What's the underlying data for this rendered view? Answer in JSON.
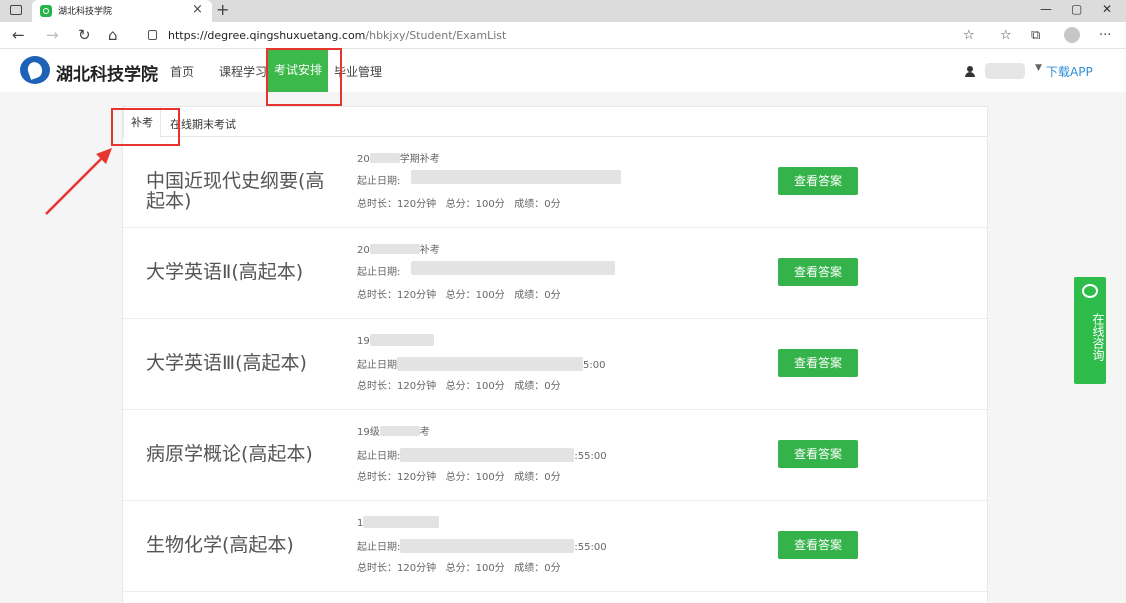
{
  "browser": {
    "tab_title": "湖北科技学院",
    "url_host": "https://degree.qingshuxuetang.com",
    "url_path": "/hbkjxy/Student/ExamList"
  },
  "site": {
    "logo": "湖北科技学院",
    "nav": [
      "首页",
      "课程学习",
      "考试安排",
      "毕业管理"
    ],
    "download": "下载APP"
  },
  "tabs": [
    "补考",
    "在线期末考试"
  ],
  "exams": [
    {
      "course": "中国近现代史纲要(高起本)",
      "term": "20",
      "term_tail": "学期补考",
      "date_label": "起止日期:",
      "date_tail": "",
      "duration": "总时长：120分钟",
      "total": "总分：100分",
      "score": "成绩：0分",
      "button": "查看答案"
    },
    {
      "course": "大学英语Ⅱ(高起本)",
      "term": "20",
      "term_tail": "补考",
      "date_label": "起止日期:",
      "date_tail": "",
      "duration": "总时长：120分钟",
      "total": "总分：100分",
      "score": "成绩：0分",
      "button": "查看答案"
    },
    {
      "course": "大学英语Ⅲ(高起本)",
      "term": "19",
      "term_tail": "",
      "date_label": "起止日期",
      "date_tail": "5:00",
      "duration": "总时长：120分钟",
      "total": "总分：100分",
      "score": "成绩：0分",
      "button": "查看答案"
    },
    {
      "course": "病原学概论(高起本)",
      "term": "19级",
      "term_tail": "考",
      "date_label": "起止日期:",
      "date_tail": ":55:00",
      "duration": "总时长：120分钟",
      "total": "总分：100分",
      "score": "成绩：0分",
      "button": "查看答案"
    },
    {
      "course": "生物化学(高起本)",
      "term": "1",
      "term_tail": "",
      "date_label": "起止日期:",
      "date_tail": ":55:00",
      "duration": "总时长：120分钟",
      "total": "总分：100分",
      "score": "成绩：0分",
      "button": "查看答案"
    }
  ],
  "consult": "在线咨询",
  "colors": {
    "accent": "#3cb94a",
    "annotation": "#e8342f",
    "link": "#2f8fd8"
  }
}
